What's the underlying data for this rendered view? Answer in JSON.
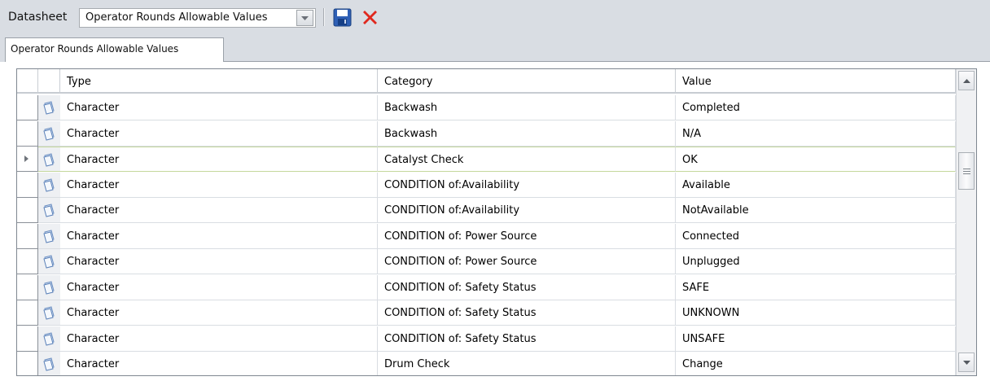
{
  "toolbar": {
    "datasheet_label": "Datasheet",
    "datasheet_value": "Operator Rounds Allowable Values",
    "save_icon": "save-icon",
    "cancel_icon": "cancel-x-icon"
  },
  "tabs": [
    {
      "label": "Operator Rounds Allowable Values",
      "active": true
    }
  ],
  "grid": {
    "columns": [
      "Type",
      "Category",
      "Value"
    ],
    "current_row_index": 2,
    "rows": [
      {
        "type": "Character",
        "category": "Backwash",
        "value": "Completed"
      },
      {
        "type": "Character",
        "category": "Backwash",
        "value": "N/A"
      },
      {
        "type": "Character",
        "category": "Catalyst Check",
        "value": "OK"
      },
      {
        "type": "Character",
        "category": "CONDITION of:Availability",
        "value": "Available"
      },
      {
        "type": "Character",
        "category": "CONDITION of:Availability",
        "value": "NotAvailable"
      },
      {
        "type": "Character",
        "category": "CONDITION of: Power Source",
        "value": "Connected"
      },
      {
        "type": "Character",
        "category": "CONDITION of: Power Source",
        "value": "Unplugged"
      },
      {
        "type": "Character",
        "category": "CONDITION of: Safety Status",
        "value": "SAFE"
      },
      {
        "type": "Character",
        "category": "CONDITION of: Safety Status",
        "value": "UNKNOWN"
      },
      {
        "type": "Character",
        "category": "CONDITION of: Safety Status",
        "value": "UNSAFE"
      },
      {
        "type": "Character",
        "category": "Drum Check",
        "value": "Change"
      }
    ]
  },
  "colors": {
    "toolbar_bg": "#d9dde3",
    "grid_border": "#7f8791",
    "current_row_border": "#c4d79c",
    "cancel_red": "#e0281e",
    "save_blue": "#2e5fb5"
  }
}
